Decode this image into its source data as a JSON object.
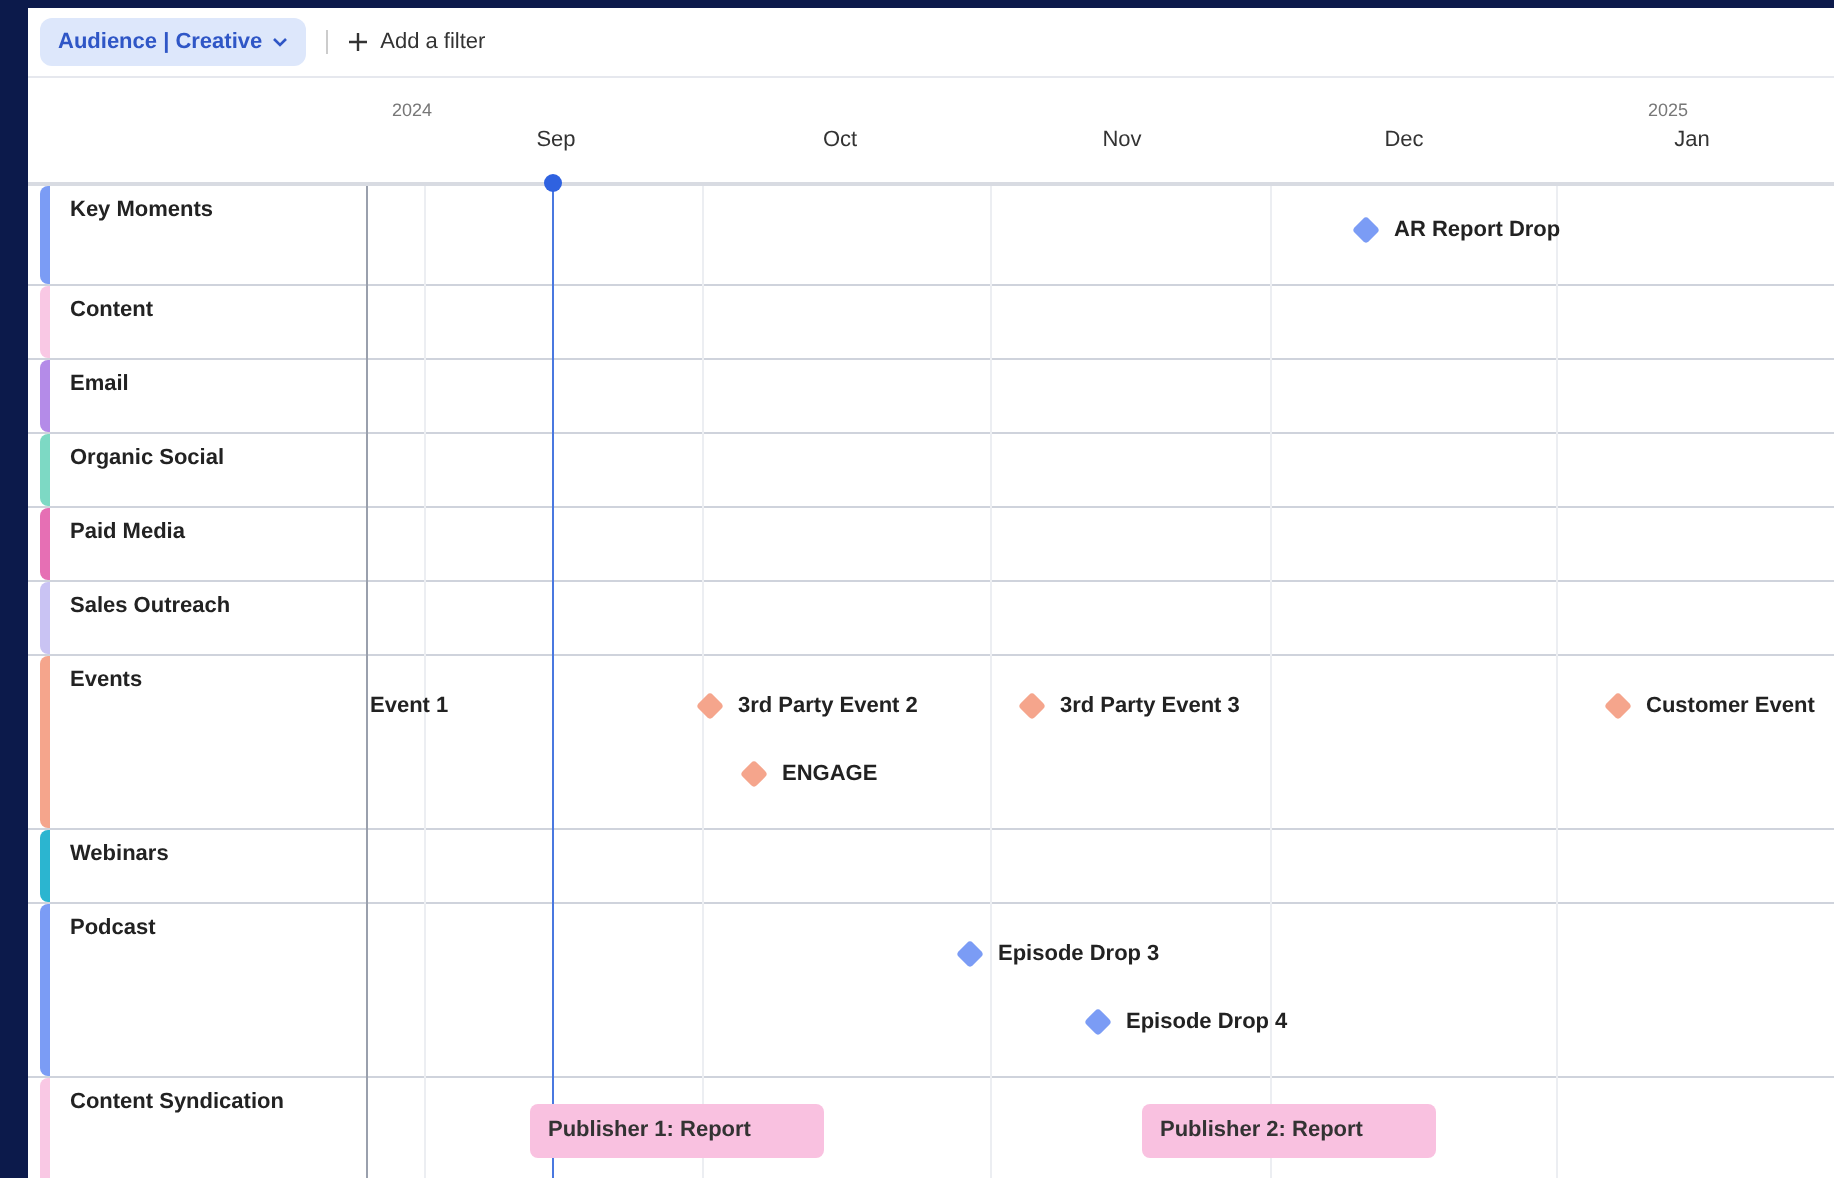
{
  "toolbar": {
    "view_chip": "Audience | Creative",
    "add_filter": "Add a filter"
  },
  "timeline": {
    "years": [
      {
        "label": "2024"
      },
      {
        "label": "2025"
      }
    ],
    "months": [
      {
        "label": "Sep"
      },
      {
        "label": "Oct"
      },
      {
        "label": "Nov"
      },
      {
        "label": "Dec"
      },
      {
        "label": "Jan"
      }
    ]
  },
  "rows": [
    {
      "label": "Key Moments",
      "color": "#7b9cf5",
      "items": [
        {
          "kind": "milestone",
          "label": "AR Report Drop",
          "color": "#7b9cf5"
        }
      ]
    },
    {
      "label": "Content",
      "color": "#f9c8e4",
      "items": []
    },
    {
      "label": "Email",
      "color": "#b48be8",
      "items": []
    },
    {
      "label": "Organic Social",
      "color": "#7dd9c4",
      "items": []
    },
    {
      "label": "Paid Media",
      "color": "#e66fb4",
      "items": []
    },
    {
      "label": "Sales Outreach",
      "color": "#c9c3f3",
      "items": []
    },
    {
      "label": "Events",
      "color": "#f5a58c",
      "items": [
        {
          "kind": "label",
          "label": "Event 1"
        },
        {
          "kind": "milestone",
          "label": "3rd Party Event 2",
          "color": "#f5a58c"
        },
        {
          "kind": "milestone",
          "label": "3rd Party Event 3",
          "color": "#f5a58c"
        },
        {
          "kind": "milestone",
          "label": "Customer Event",
          "color": "#f5a58c"
        },
        {
          "kind": "milestone",
          "label": "ENGAGE",
          "color": "#f5a58c"
        }
      ]
    },
    {
      "label": "Webinars",
      "color": "#2bb5d0",
      "items": []
    },
    {
      "label": "Podcast",
      "color": "#7b9cf5",
      "items": [
        {
          "kind": "milestone",
          "label": "Episode Drop 3",
          "color": "#7b9cf5"
        },
        {
          "kind": "milestone",
          "label": "Episode Drop 4",
          "color": "#7b9cf5"
        }
      ]
    },
    {
      "label": "Content Syndication",
      "color": "#f9c8e4",
      "items": [
        {
          "kind": "bar",
          "label": "Publisher 1: Report",
          "color": "#f9c1e0"
        },
        {
          "kind": "bar",
          "label": "Publisher 2: Report",
          "color": "#f9c1e0"
        }
      ]
    }
  ]
}
